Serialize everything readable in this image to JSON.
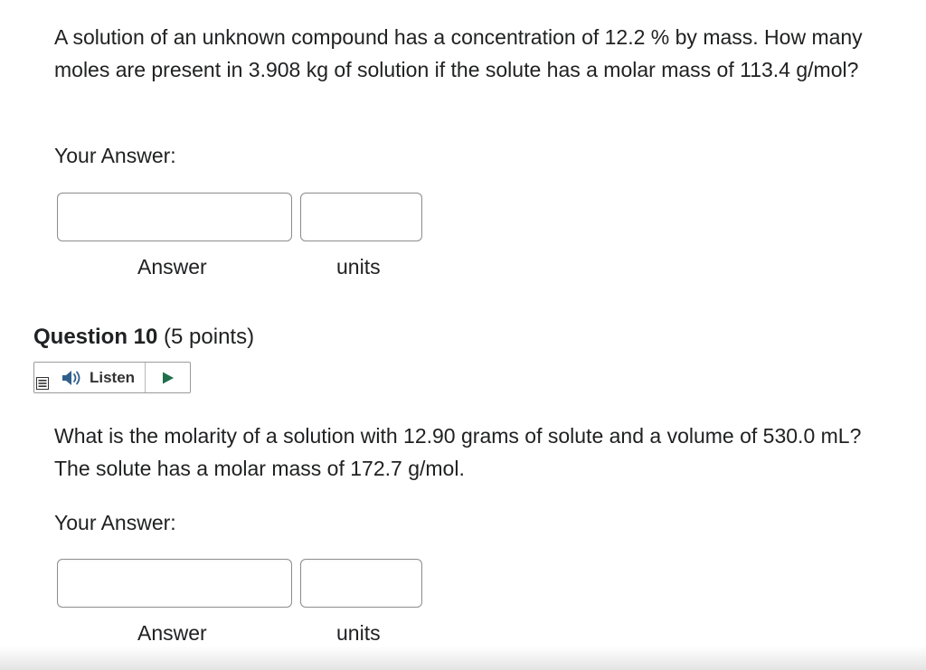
{
  "question9": {
    "text": "A solution of an unknown compound has a concentration of 12.2 % by mass. How many moles are present in 3.908 kg of solution if the solute has a molar mass of 113.4 g/mol?",
    "your_answer_label": "Your Answer:",
    "answer_value": "",
    "units_value": "",
    "answer_label": "Answer",
    "units_label": "units"
  },
  "question10": {
    "title": "Question 10",
    "points": "(5 points)",
    "text": "What is the molarity of a solution with 12.90 grams of solute and a volume of 530.0 mL?  The solute has a molar mass of 172.7 g/mol.",
    "your_answer_label": "Your Answer:",
    "answer_value": "",
    "units_value": "",
    "answer_label": "Answer",
    "units_label": "units"
  },
  "listen": {
    "label": "Listen",
    "menu_icon": "menu-icon",
    "speaker_icon": "speaker-icon",
    "play_icon": "play-icon",
    "accent_color": "#2f5f8c",
    "play_color": "#1f6f4a"
  }
}
